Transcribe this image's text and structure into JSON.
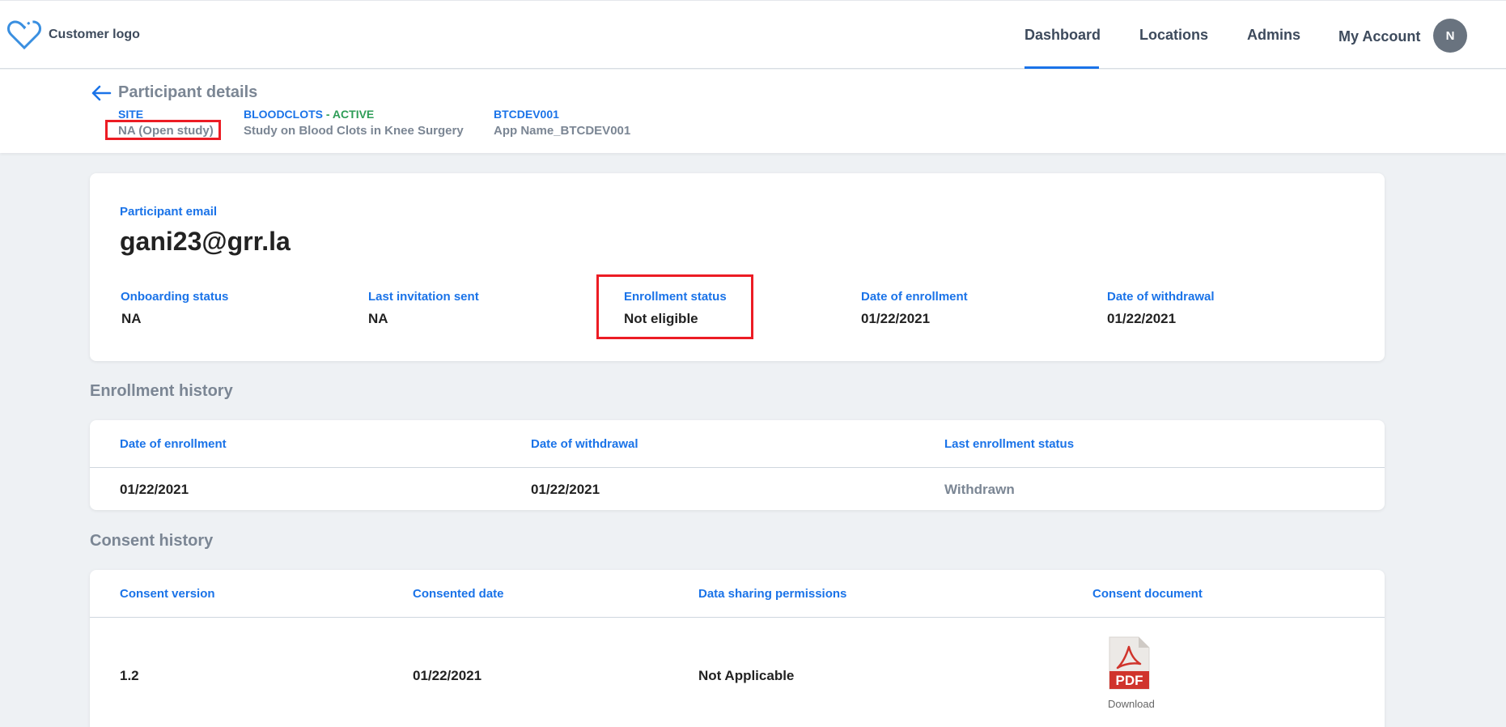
{
  "header": {
    "logo_text": "Customer logo",
    "nav": [
      "Dashboard",
      "Locations",
      "Admins",
      "My Account"
    ],
    "active_nav": "Dashboard",
    "avatar_initial": "N"
  },
  "subheader": {
    "title": "Participant details",
    "site_label": "SITE",
    "site_value": "NA (Open study)",
    "study_label": "BLOODCLOTS - ACTIVE",
    "study_value": "Study on Blood Clots in Knee Surgery",
    "app_label": "BTCDEV001",
    "app_value": "App Name_BTCDEV001"
  },
  "participant": {
    "email_label": "Participant email",
    "email": "gani23@grr.la",
    "fields": [
      {
        "label": "Onboarding status",
        "value": "NA"
      },
      {
        "label": "Last invitation sent",
        "value": "NA"
      },
      {
        "label": "Enrollment status",
        "value": "Not eligible"
      },
      {
        "label": "Date of enrollment",
        "value": "01/22/2021"
      },
      {
        "label": "Date of withdrawal",
        "value": "01/22/2021"
      }
    ]
  },
  "enrollment_history": {
    "title": "Enrollment history",
    "headers": [
      "Date of enrollment",
      "Date of withdrawal",
      "Last enrollment status"
    ],
    "rows": [
      [
        "01/22/2021",
        "01/22/2021",
        "Withdrawn"
      ]
    ]
  },
  "consent_history": {
    "title": "Consent history",
    "headers": [
      "Consent version",
      "Consented date",
      "Data sharing permissions",
      "Consent document"
    ],
    "rows": [
      [
        "1.2",
        "01/22/2021",
        "Not Applicable"
      ]
    ],
    "pdf_label": "PDF",
    "download_label": "Download"
  },
  "colors": {
    "accent": "#1a73e8",
    "highlight": "#ec1c24",
    "active_study": "#2e9d57"
  }
}
